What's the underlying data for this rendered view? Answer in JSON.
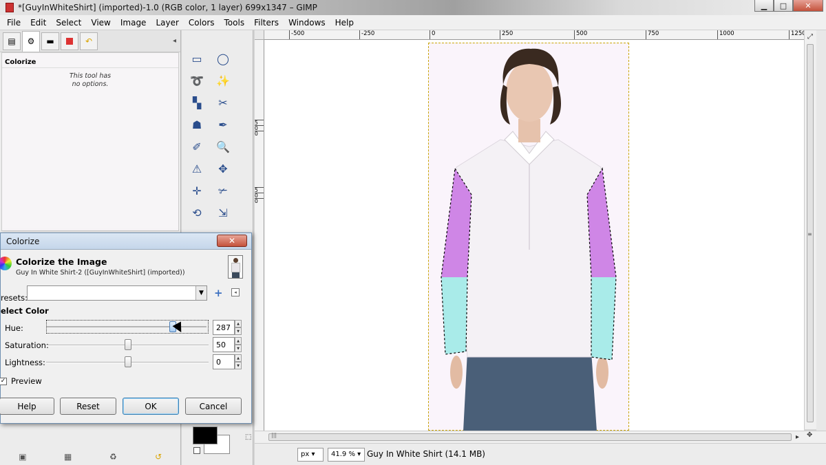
{
  "window": {
    "title": "*[GuyInWhiteShirt] (imported)-1.0 (RGB color, 1 layer) 699x1347 – GIMP",
    "minimize": "▁",
    "maximize": "□",
    "close": "✕"
  },
  "menu": [
    "File",
    "Edit",
    "Select",
    "View",
    "Image",
    "Layer",
    "Colors",
    "Tools",
    "Filters",
    "Windows",
    "Help"
  ],
  "tool_options": {
    "title": "Colorize",
    "message_line1": "This tool has",
    "message_line2": "no options."
  },
  "rulers": {
    "h_labels": [
      "-500",
      "-250",
      "0",
      "250",
      "500",
      "750",
      "1000",
      "1250"
    ],
    "v_labels": [
      "5",
      "0",
      "0",
      "5",
      "0",
      "0"
    ]
  },
  "status": {
    "unit": "px",
    "zoom": "41.9 %",
    "layer_info": "Guy In White Shirt (14.1 MB)"
  },
  "dialog": {
    "title": "Colorize",
    "close": "✕",
    "heading": "Colorize the Image",
    "subtitle": "Guy In White Shirt-2 ([GuyInWhiteShirt] (imported))",
    "presets_label": "resets:",
    "presets_value": "",
    "section": "elect Color",
    "hue_label": "Hue:",
    "hue_value": "287",
    "hue_fraction": 0.8,
    "saturation_label": "Saturation:",
    "saturation_value": "50",
    "lightness_label": "Lightness:",
    "lightness_value": "0",
    "preview_label": "Preview",
    "buttons": {
      "help": "Help",
      "reset": "Reset",
      "ok": "OK",
      "cancel": "Cancel"
    }
  },
  "colors": {
    "foreground": "#000000",
    "background": "#ffffff",
    "sleeve_upper": "#cf86e6",
    "sleeve_lower": "#a9ebe9",
    "selection_border": "#c8a400"
  },
  "icons": {
    "presets_add": "plus-icon",
    "presets_menu": "tab-menu-icon",
    "dialog_image": "colorize-icon"
  }
}
